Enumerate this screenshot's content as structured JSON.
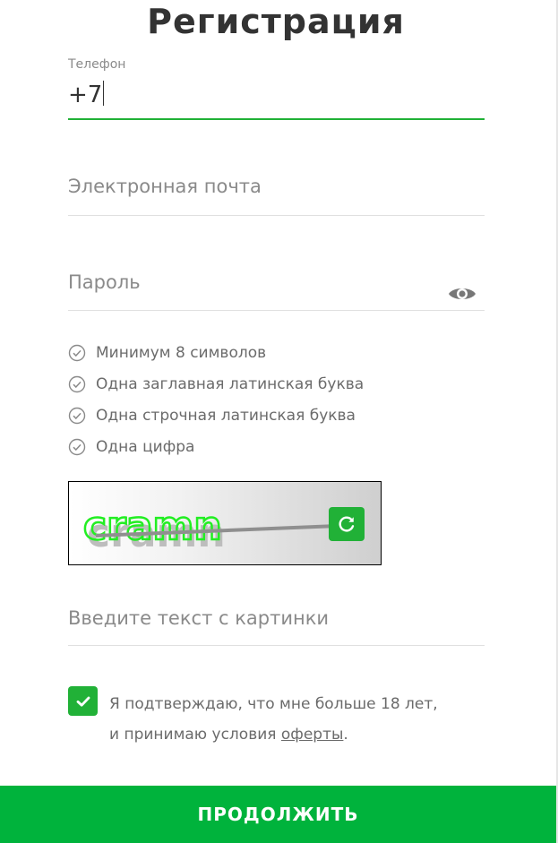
{
  "page": {
    "title": "Регистрация"
  },
  "phone": {
    "label": "Телефон",
    "value": "+7"
  },
  "email": {
    "placeholder": "Электронная почта"
  },
  "password": {
    "placeholder": "Пароль",
    "toggle_icon": "eye-icon"
  },
  "password_rules": [
    {
      "text": "Минимум 8 символов",
      "icon": "check-circle-icon"
    },
    {
      "text": "Одна заглавная латинская буква",
      "icon": "check-circle-icon"
    },
    {
      "text": "Одна строчная латинская буква",
      "icon": "check-circle-icon"
    },
    {
      "text": "Одна цифра",
      "icon": "check-circle-icon"
    }
  ],
  "captcha": {
    "text": "cramn",
    "refresh_icon": "refresh-icon"
  },
  "captcha_input": {
    "placeholder": "Введите текст с картинки"
  },
  "agreement": {
    "checked": true,
    "line1": "Я подтверждаю, что мне больше 18 лет,",
    "line2_prefix": "и принимаю условия ",
    "link_text": "оферты",
    "line2_suffix": "."
  },
  "continue_button": {
    "label": "ПРОДОЛЖИТЬ"
  },
  "colors": {
    "accent": "#21b137",
    "button": "#00b33c"
  }
}
